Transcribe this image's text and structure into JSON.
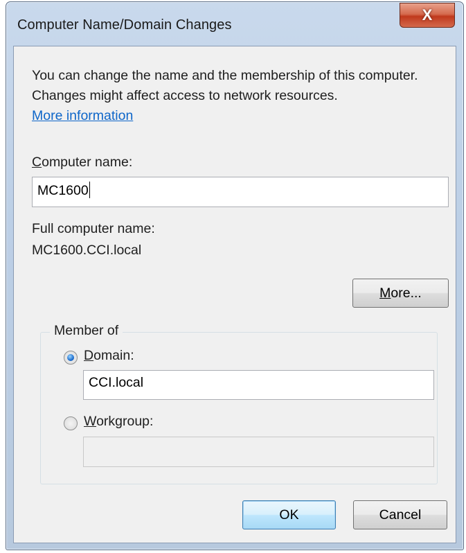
{
  "window": {
    "title": "Computer Name/Domain Changes",
    "close_glyph": "X"
  },
  "intro": {
    "text": "You can change the name and the membership of this computer. Changes might affect access to network resources.",
    "link": "More information"
  },
  "computer_name": {
    "label_hotkey": "C",
    "label_rest": "omputer name:",
    "value": "MC1600"
  },
  "full_name": {
    "label": "Full computer name:",
    "value": "MC1600.CCI.local"
  },
  "more_button": {
    "hotkey": "M",
    "rest": "ore..."
  },
  "member_of": {
    "legend": "Member of",
    "domain": {
      "hotkey": "D",
      "rest": "omain:",
      "value": "CCI.local",
      "selected": true
    },
    "workgroup": {
      "hotkey": "W",
      "rest": "orkgroup:",
      "value": "",
      "selected": false
    }
  },
  "buttons": {
    "ok": "OK",
    "cancel": "Cancel"
  },
  "colors": {
    "link": "#0e66c9",
    "close": "#c0391d",
    "window_frame": "#bccfe6",
    "default_button": "#bee6fd"
  }
}
